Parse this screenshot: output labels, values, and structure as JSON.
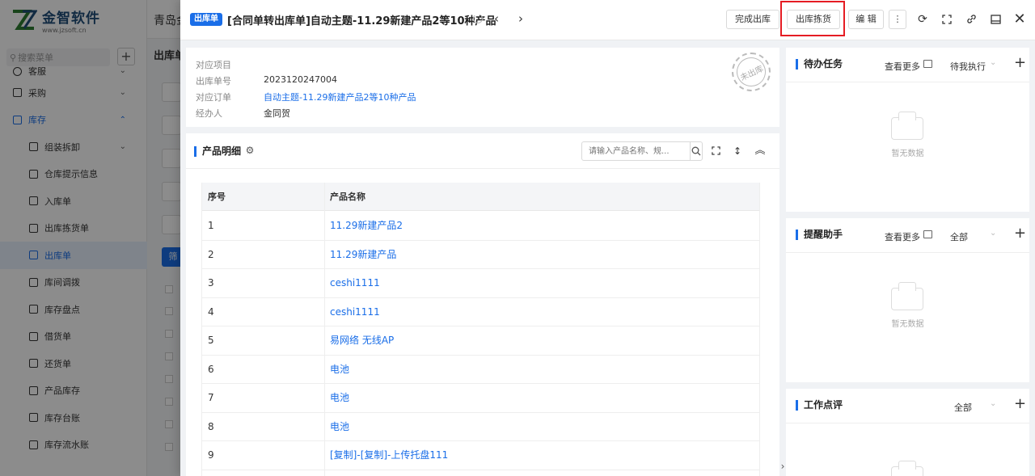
{
  "app": {
    "logo_title": "金智软件",
    "logo_url": "www.jzsoft.cn",
    "top_title": "青岛金",
    "search_placeholder": "搜索菜单",
    "sub_title": "出库单",
    "bg_button": "筛"
  },
  "sidebar": {
    "items": [
      {
        "label": "客服"
      },
      {
        "label": "采购"
      },
      {
        "label": "库存"
      },
      {
        "label": "组装拆卸"
      },
      {
        "label": "仓库提示信息"
      },
      {
        "label": "入库单"
      },
      {
        "label": "出库拣货单"
      },
      {
        "label": "出库单"
      },
      {
        "label": "库间调拨"
      },
      {
        "label": "库存盘点"
      },
      {
        "label": "借货单"
      },
      {
        "label": "还货单"
      },
      {
        "label": "产品库存"
      },
      {
        "label": "库存台账"
      },
      {
        "label": "库存流水账"
      }
    ]
  },
  "drawer": {
    "badge": "出库单",
    "title": "[合同单转出库单]自动主题-11.29新建产品2等10种产品",
    "prev_label": "‹",
    "next_label": "›",
    "buttons": {
      "complete": "完成出库",
      "pick": "出库拣货",
      "edit": "编 辑",
      "more": "⋮"
    }
  },
  "info": {
    "rows": [
      {
        "label": "对应项目",
        "value": ""
      },
      {
        "label": "出库单号",
        "value": "2023120247004"
      },
      {
        "label": "对应订单",
        "value": "自动主题-11.29新建产品2等10种产品"
      },
      {
        "label": "经办人",
        "value": "金同贺"
      }
    ],
    "stamp": "未出库"
  },
  "products": {
    "section_title": "产品明细",
    "search_placeholder": "请输入产品名称、规...",
    "columns": [
      "序号",
      "产品名称"
    ],
    "rows": [
      {
        "no": "1",
        "name": "11.29新建产品2"
      },
      {
        "no": "2",
        "name": "11.29新建产品"
      },
      {
        "no": "3",
        "name": "ceshi1111"
      },
      {
        "no": "4",
        "name": "ceshi1111"
      },
      {
        "no": "5",
        "name": "易网络 无线AP"
      },
      {
        "no": "6",
        "name": "电池"
      },
      {
        "no": "7",
        "name": "电池"
      },
      {
        "no": "8",
        "name": "电池"
      },
      {
        "no": "9",
        "name": "[复制]-[复制]-上传托盘111"
      }
    ]
  },
  "panels": {
    "todo": {
      "title": "待办任务",
      "more": "查看更多",
      "filter": "待我执行",
      "empty": "暂无数据"
    },
    "reminder": {
      "title": "提醒助手",
      "more": "查看更多",
      "filter": "全部",
      "empty": "暂无数据"
    },
    "review": {
      "title": "工作点评",
      "filter": "全部"
    }
  },
  "colors": {
    "accent": "#1a6ee8",
    "highlight": "#e51c23"
  }
}
